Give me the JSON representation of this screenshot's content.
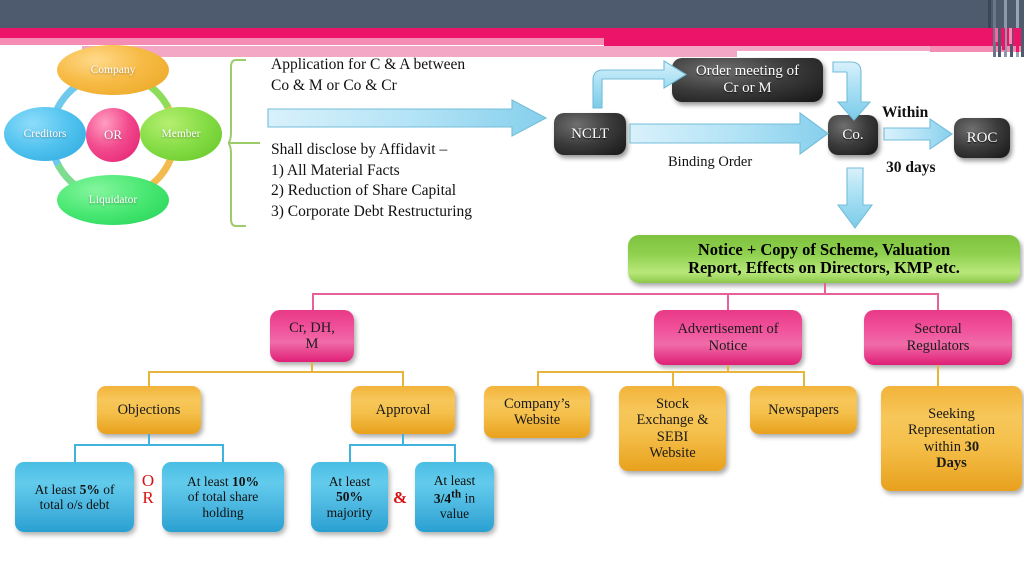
{
  "decor": {
    "band_dark_color": "#4e5a6e",
    "band_magenta_color": "#ec1468",
    "band_pink_color": "#f3a7c5"
  },
  "cluster": {
    "company": "Company",
    "creditors": "Creditors",
    "member": "Member",
    "liquidator": "Liquidator",
    "center": "OR"
  },
  "left_text": {
    "application_line1": "Application for  C & A between",
    "application_line2": "Co & M or Co & Cr",
    "affidavit_heading": "Shall disclose by Affidavit –",
    "affidavit_items": [
      "1)   All Material Facts",
      "2)   Reduction of Share Capital",
      "3)   Corporate Debt Restructuring"
    ]
  },
  "flow": {
    "nclt": "NCLT",
    "order_meeting_line1": "Order meeting of",
    "order_meeting_line2": "Cr or M",
    "binding_order": "Binding Order",
    "company": "Co.",
    "roc": "ROC",
    "within": "Within",
    "days": "30 days"
  },
  "notice": {
    "line1": "Notice + Copy of Scheme, Valuation",
    "line2": "Report, Effects on Directors, KMP etc."
  },
  "branches": {
    "cr_dh_m_line1": "Cr,  DH,",
    "cr_dh_m_line2": "M",
    "advertisement_line1": "Advertisement of",
    "advertisement_line2": "Notice",
    "sectoral_line1": "Sectoral",
    "sectoral_line2": "Regulators"
  },
  "objection_branch": {
    "objections": "Objections",
    "approval": "Approval",
    "or_label": "OR",
    "amp_label": "&",
    "debt_line1": "At least 5% of",
    "debt_line2": "total o/s debt",
    "share_line1": "At least 10%",
    "share_line2": "of total share",
    "share_line3": "holding",
    "majority_line1": "At least",
    "majority_line2": "50%",
    "majority_line3": "majority",
    "value_line1": "At least",
    "value_line2": "3/4th in",
    "value_line3": "value"
  },
  "advertisement_children": [
    {
      "line1": "Company’s",
      "line2": "Website",
      "line3": "",
      "line4": ""
    },
    {
      "line1": "Stock",
      "line2": "Exchange &",
      "line3": "SEBI",
      "line4": "Website"
    },
    {
      "line1": "Newspapers",
      "line2": "",
      "line3": "",
      "line4": ""
    }
  ],
  "sectoral_children": [
    {
      "line1": "Seeking",
      "line2": "Representation",
      "line3": "within 30",
      "line4": "Days"
    }
  ],
  "colors": {
    "dark_node": "#2b2b2b",
    "green_notice": "#8fd14f",
    "pink_node": "#ec3c8a",
    "gold_node": "#f2b33a",
    "blue_node": "#49bde4",
    "arrow_blue": "#a8e2f5",
    "brace_green": "#9ccb6a",
    "red_accent": "#d81212"
  }
}
